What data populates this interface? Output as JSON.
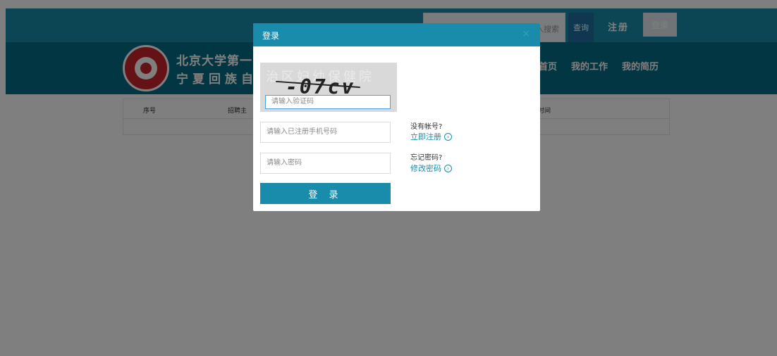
{
  "topbar": {
    "search_placeholder": "请输入搜索",
    "query_label": "查询",
    "register_label": "注册",
    "login_label": "登录"
  },
  "header": {
    "name_line1": "北京大学第一医",
    "name_line2": "宁夏回族自",
    "nav": [
      "首页",
      "我的工作",
      "我的简历"
    ]
  },
  "table": {
    "columns": [
      "序号",
      "招聘主",
      "时间"
    ]
  },
  "modal": {
    "title": "登录",
    "close_glyph": "×",
    "captcha_code": "-07cv",
    "captcha_noise": "治区妇幼保健院",
    "captcha_placeholder": "请输入验证码",
    "phone_placeholder": "请输入已注册手机号码",
    "password_placeholder": "请输入密码",
    "submit_label": "登 录",
    "no_account_text": "没有帐号?",
    "register_now": "立即注册",
    "forgot_text": "忘记密码?",
    "change_password": "修改密码"
  },
  "colors": {
    "primary": "#198cab",
    "header_bg": "#066d86",
    "logo_red": "#c8242c"
  },
  "icons": {
    "arrow_circle": "arrow-right-circle-icon",
    "close": "close-icon"
  }
}
